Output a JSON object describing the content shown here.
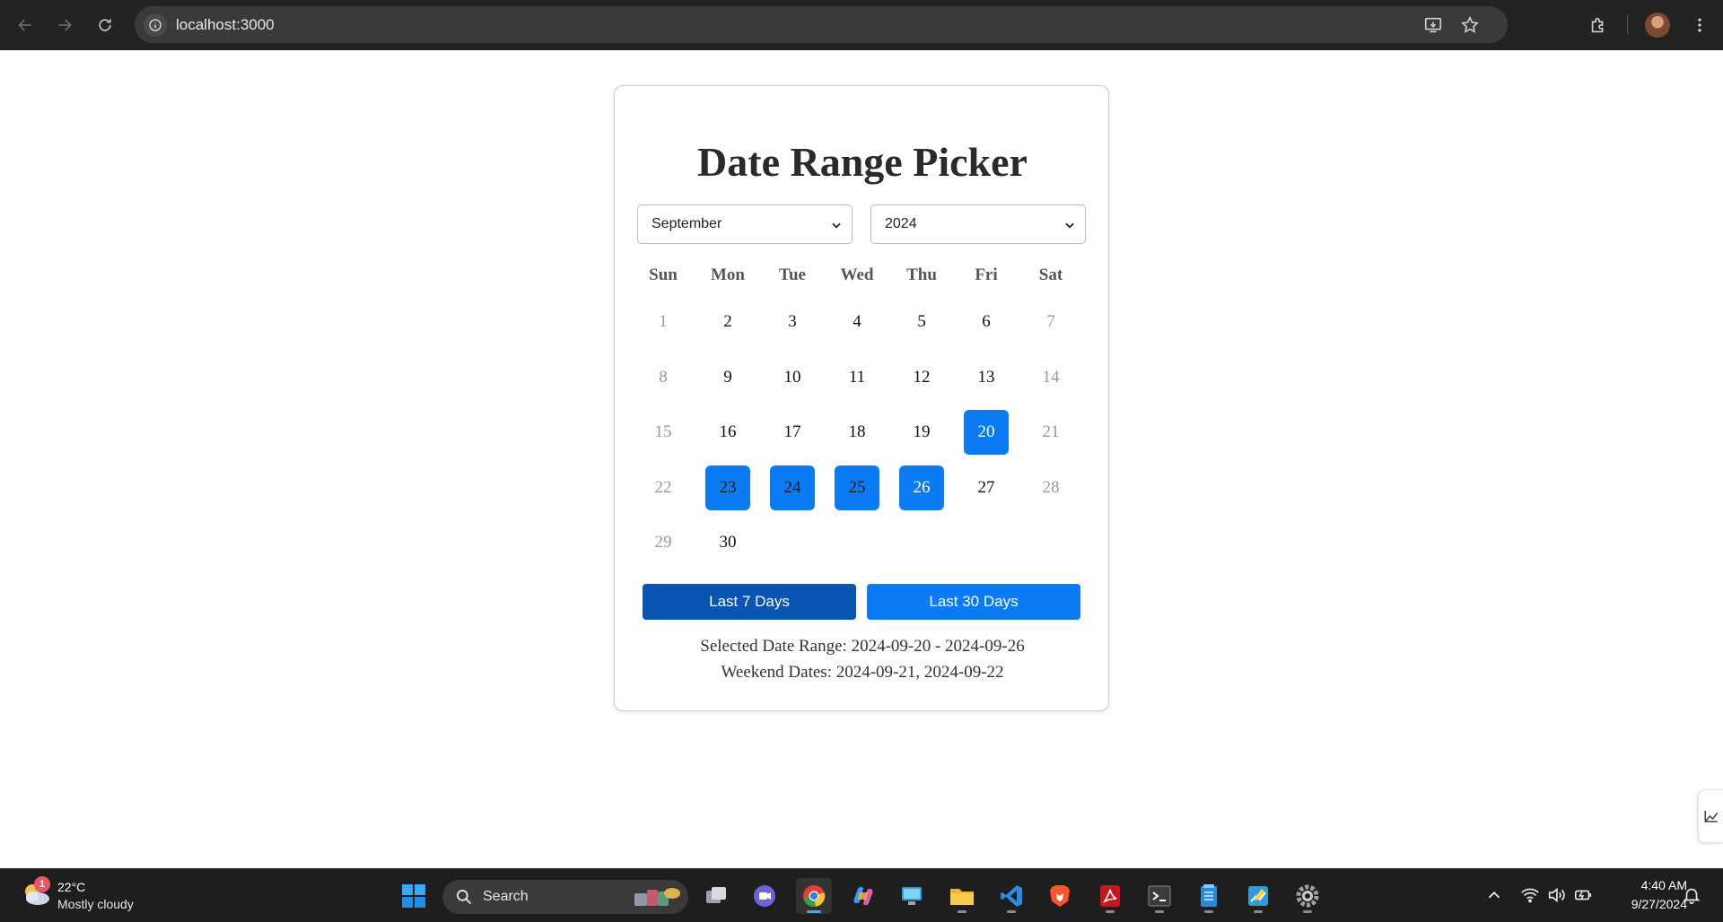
{
  "browser": {
    "url": "localhost:3000"
  },
  "picker": {
    "title": "Date Range Picker",
    "month_value": "September",
    "year_value": "2024",
    "weekdays": [
      "Sun",
      "Mon",
      "Tue",
      "Wed",
      "Thu",
      "Fri",
      "Sat"
    ],
    "days": [
      {
        "label": "1",
        "weekend": true,
        "selected": false
      },
      {
        "label": "2",
        "weekend": false,
        "selected": false
      },
      {
        "label": "3",
        "weekend": false,
        "selected": false
      },
      {
        "label": "4",
        "weekend": false,
        "selected": false
      },
      {
        "label": "5",
        "weekend": false,
        "selected": false
      },
      {
        "label": "6",
        "weekend": false,
        "selected": false
      },
      {
        "label": "7",
        "weekend": true,
        "selected": false
      },
      {
        "label": "8",
        "weekend": true,
        "selected": false
      },
      {
        "label": "9",
        "weekend": false,
        "selected": false
      },
      {
        "label": "10",
        "weekend": false,
        "selected": false
      },
      {
        "label": "11",
        "weekend": false,
        "selected": false
      },
      {
        "label": "12",
        "weekend": false,
        "selected": false
      },
      {
        "label": "13",
        "weekend": false,
        "selected": false
      },
      {
        "label": "14",
        "weekend": true,
        "selected": false
      },
      {
        "label": "15",
        "weekend": true,
        "selected": false
      },
      {
        "label": "16",
        "weekend": false,
        "selected": false
      },
      {
        "label": "17",
        "weekend": false,
        "selected": false
      },
      {
        "label": "18",
        "weekend": false,
        "selected": false
      },
      {
        "label": "19",
        "weekend": false,
        "selected": false
      },
      {
        "label": "20",
        "weekend": false,
        "selected": true,
        "range_edge": true
      },
      {
        "label": "21",
        "weekend": true,
        "selected": false
      },
      {
        "label": "22",
        "weekend": true,
        "selected": false
      },
      {
        "label": "23",
        "weekend": false,
        "selected": true
      },
      {
        "label": "24",
        "weekend": false,
        "selected": true
      },
      {
        "label": "25",
        "weekend": false,
        "selected": true
      },
      {
        "label": "26",
        "weekend": false,
        "selected": true,
        "range_edge": true
      },
      {
        "label": "27",
        "weekend": false,
        "selected": false
      },
      {
        "label": "28",
        "weekend": true,
        "selected": false
      },
      {
        "label": "29",
        "weekend": true,
        "selected": false
      },
      {
        "label": "30",
        "weekend": false,
        "selected": false
      }
    ],
    "buttons": {
      "last7": "Last 7 Days",
      "last30": "Last 30 Days"
    },
    "selected_range_text": "Selected Date Range: 2024-09-20 - 2024-09-26",
    "weekend_dates_text": "Weekend Dates: 2024-09-21, 2024-09-22",
    "colors": {
      "accent": "#0a7bf3",
      "accent_dark": "#0a55b1"
    }
  },
  "taskbar": {
    "weather_badge": "1",
    "temperature": "22°C",
    "condition": "Mostly cloudy",
    "search_label": "Search",
    "time": "4:40 AM",
    "date": "9/27/2024",
    "apps": [
      "task-view",
      "teams-chat",
      "chrome",
      "copilot",
      "remote-desktop",
      "file-explorer",
      "vscode",
      "brave",
      "acrobat",
      "terminal",
      "notepad",
      "paint",
      "settings"
    ]
  }
}
